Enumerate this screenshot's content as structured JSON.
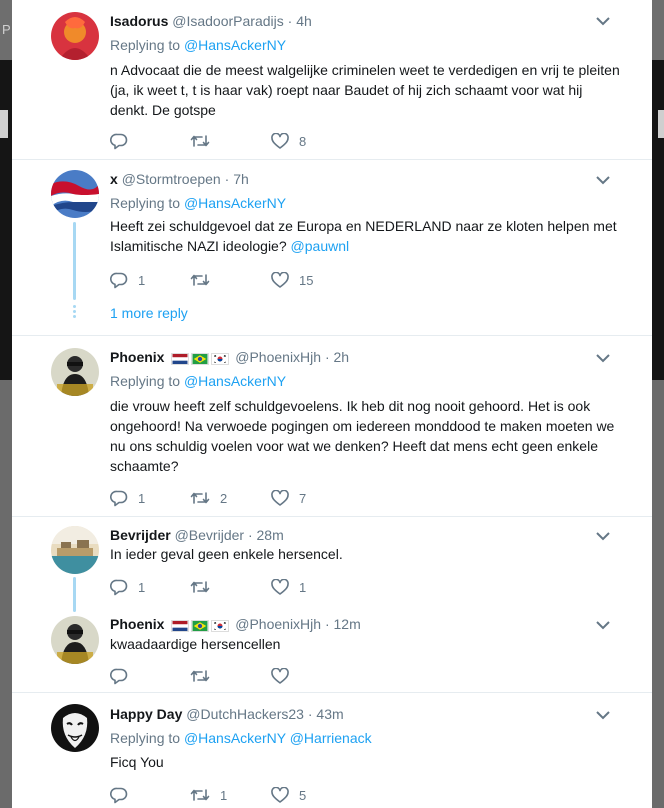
{
  "background": {
    "letter": "P"
  },
  "tweets": [
    {
      "name": "Isadorus",
      "handle": "@IsadoorParadijs",
      "time": "4h",
      "replying_label": "Replying to",
      "replying_to": [
        "@HansAckerNY"
      ],
      "text": "n Advocaat die de meest walgelijke criminelen weet te verdedigen en vrij te pleiten (ja, ik weet t, t is haar vak) roept naar Baudet of hij zich schaamt voor wat hij denkt. De gotspe",
      "replies": "",
      "retweets": "",
      "likes": "8"
    },
    {
      "name": "x",
      "handle": "@Stormtroepen",
      "time": "7h",
      "replying_label": "Replying to",
      "replying_to": [
        "@HansAckerNY"
      ],
      "text": "Heeft zei schuldgevoel dat ze Europa en NEDERLAND naar ze kloten helpen met Islamitische NAZI ideologie?",
      "mention_inline": "@pauwnl",
      "replies": "1",
      "retweets": "",
      "likes": "15",
      "more_replies": "1 more reply"
    },
    {
      "name": "Phoenix",
      "handle": "@PhoenixHjh",
      "time": "2h",
      "replying_label": "Replying to",
      "replying_to": [
        "@HansAckerNY"
      ],
      "text": "die vrouw heeft zelf schuldgevoelens. Ik heb dit nog nooit gehoord. Het is ook ongehoord! Na verwoede pogingen om iedereen monddood te maken moeten we nu ons schuldig voelen voor wat we denken? Heeft dat mens echt geen enkele schaamte?",
      "replies": "1",
      "retweets": "2",
      "likes": "7"
    },
    {
      "name": "Bevrijder",
      "handle": "@Bevrijder",
      "time": "28m",
      "text": "In ieder geval geen enkele hersencel.",
      "replies": "1",
      "retweets": "",
      "likes": "1"
    },
    {
      "name": "Phoenix",
      "handle": "@PhoenixHjh",
      "time": "12m",
      "text": "kwaadaardige hersencellen",
      "replies": "",
      "retweets": "",
      "likes": ""
    },
    {
      "name": "Happy Day",
      "handle": "@DutchHackers23",
      "time": "43m",
      "replying_label": "Replying to",
      "replying_to": [
        "@HansAckerNY",
        "@Harrienack"
      ],
      "text": "Ficq You",
      "replies": "",
      "retweets": "1",
      "likes": "5"
    }
  ],
  "icons": {
    "reply": "reply-icon",
    "retweet": "retweet-icon",
    "like": "heart-icon",
    "menu": "chevron-down-icon"
  },
  "colors": {
    "link": "#1da1f2",
    "muted": "#657786",
    "thread_line": "#a7d8f3",
    "text": "#14171a"
  }
}
